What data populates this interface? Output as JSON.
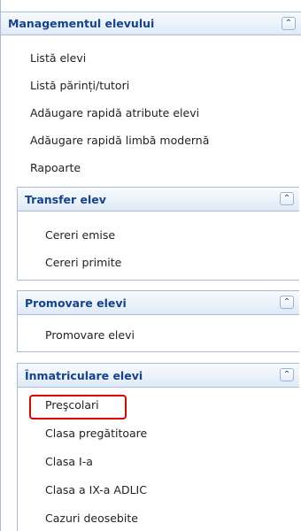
{
  "management": {
    "title": "Managementul elevului",
    "items": [
      "Listă elevi",
      "Listă părinți/tutori",
      "Adăugare rapidă atribute elevi",
      "Adăugare rapidă limbă modernă",
      "Rapoarte"
    ]
  },
  "transfer": {
    "title": "Transfer elev",
    "items": [
      "Cereri emise",
      "Cereri primite"
    ]
  },
  "promovare": {
    "title": "Promovare elevi",
    "items": [
      "Promovare elevi"
    ]
  },
  "inmatriculare": {
    "title": "Înmatriculare elevi",
    "items": [
      "Preşcolari",
      "Clasa pregătitoare",
      "Clasa I-a",
      "Clasa a IX-a ADLIC",
      "Cazuri deosebite"
    ]
  },
  "icons": {
    "collapse": "double-chevron-up-icon"
  },
  "colors": {
    "header_text": "#15428b",
    "border": "#a9bcd4",
    "highlight": "#e00000"
  }
}
